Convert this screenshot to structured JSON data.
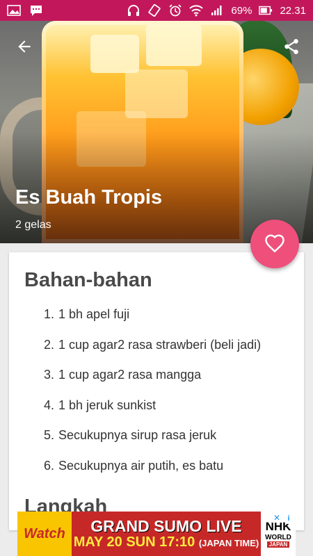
{
  "status_bar": {
    "battery": "69%",
    "time": "22.31",
    "icons": [
      "image-icon",
      "message-icon",
      "headphones-icon",
      "rotate-icon",
      "alarm-icon",
      "wifi-icon",
      "signal-icon",
      "battery-icon"
    ]
  },
  "recipe": {
    "title": "Es Buah Tropis",
    "servings": "2 gelas"
  },
  "ingredients_section": {
    "title": "Bahan-bahan",
    "items": [
      {
        "num": "1.",
        "text": "1 bh apel fuji"
      },
      {
        "num": "2.",
        "text": "1 cup agar2 rasa strawberi (beli jadi)"
      },
      {
        "num": "3.",
        "text": "1 cup agar2 rasa mangga"
      },
      {
        "num": "4.",
        "text": "1 bh jeruk sunkist"
      },
      {
        "num": "5.",
        "text": "Secukupnya sirup rasa jeruk"
      },
      {
        "num": "6.",
        "text": "Secukupnya air putih, es batu"
      }
    ]
  },
  "steps_section": {
    "title": "Langkah"
  },
  "ad": {
    "watch": "Watch",
    "line1": "GRAND SUMO LIVE",
    "line2": "MAY 20 SUN 17:10",
    "line2_suffix": "(JAPAN TIME)",
    "logo_main": "NHK",
    "logo_world": "WORLD",
    "logo_country": "JAPAN"
  },
  "colors": {
    "status_bar": "#c2185b",
    "fab": "#ee4f7b",
    "ad_red": "#c62828"
  }
}
